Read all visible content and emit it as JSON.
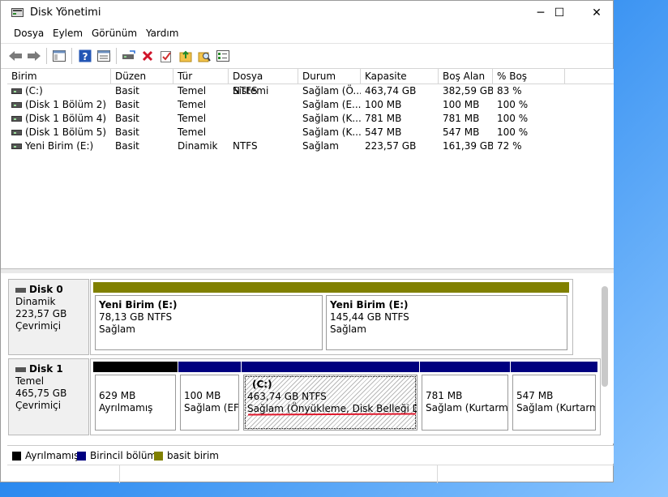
{
  "window": {
    "title": "Disk Yönetimi",
    "minimize": "─",
    "maximize": "☐",
    "close": "✕"
  },
  "menu": [
    "Dosya",
    "Eylem",
    "Görünüm",
    "Yardım"
  ],
  "toolbar_icons": [
    "back-arrow-icon",
    "forward-arrow-icon",
    "console-tree-icon",
    "help-icon",
    "properties-icon",
    "connect-drive-icon",
    "delete-icon",
    "check-icon",
    "folder-up-icon",
    "search-folder-icon",
    "settings-list-icon"
  ],
  "columns": [
    "Birim",
    "Düzen",
    "Tür",
    "Dosya Sistemi",
    "Durum",
    "Kapasite",
    "Boş Alan",
    "% Boş"
  ],
  "volumes": [
    [
      "(C:)",
      "Basit",
      "Temel",
      "NTFS",
      "Sağlam (Ö...",
      "463,74 GB",
      "382,59 GB",
      "83 %"
    ],
    [
      "(Disk 1 Bölüm 2)",
      "Basit",
      "Temel",
      "",
      "Sağlam (E...",
      "100 MB",
      "100 MB",
      "100 %"
    ],
    [
      "(Disk 1 Bölüm 4)",
      "Basit",
      "Temel",
      "",
      "Sağlam (K...",
      "781 MB",
      "781 MB",
      "100 %"
    ],
    [
      "(Disk 1 Bölüm 5)",
      "Basit",
      "Temel",
      "",
      "Sağlam (K...",
      "547 MB",
      "547 MB",
      "100 %"
    ],
    [
      "Yeni Birim (E:)",
      "Basit",
      "Dinamik",
      "NTFS",
      "Sağlam",
      "223,57 GB",
      "161,39 GB",
      "72 %"
    ]
  ],
  "disks": [
    {
      "name": "Disk 0",
      "type": "Dinamik",
      "size": "223,57 GB",
      "status": "Çevrimiçi",
      "partitions": [
        {
          "title": "Yeni Birim  (E:)",
          "line1": "78,13 GB NTFS",
          "line2": "Sağlam",
          "color": "#808000"
        },
        {
          "title": "Yeni Birim  (E:)",
          "line1": "145,44 GB NTFS",
          "line2": "Sağlam",
          "color": "#808000"
        }
      ]
    },
    {
      "name": "Disk 1",
      "type": "Temel",
      "size": "465,75 GB",
      "status": "Çevrimiçi",
      "partitions": [
        {
          "title": "",
          "line1": "629 MB",
          "line2": "Ayrılmamış",
          "color": "#000000"
        },
        {
          "title": "",
          "line1": "100 MB",
          "line2": "Sağlam (EFI",
          "color": "#00007f"
        },
        {
          "title": "(C:)",
          "line1": "463,74 GB NTFS",
          "line2": "Sağlam (Önyükleme, Disk Belleği Dosyası",
          "color": "#00007f"
        },
        {
          "title": "",
          "line1": "781 MB",
          "line2": "Sağlam (Kurtarma",
          "color": "#00007f"
        },
        {
          "title": "",
          "line1": "547 MB",
          "line2": "Sağlam (Kurtarma",
          "color": "#00007f"
        }
      ]
    }
  ],
  "legend": [
    {
      "label": "Ayrılmamış",
      "color": "#000000"
    },
    {
      "label": "Birincil bölüm",
      "color": "#00007f"
    },
    {
      "label": "basit birim",
      "color": "#808000"
    }
  ]
}
